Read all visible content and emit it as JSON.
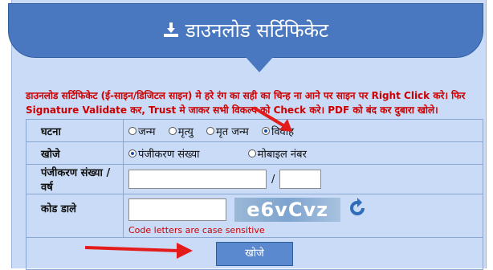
{
  "header": {
    "title": "डाउनलोड सर्टिफिकेट",
    "icon": "download-icon"
  },
  "notice": "डाउनलोड सर्टिफिकेट (ई-साइन/डिजिटल साइन) मे हरे रंग का सही का चिन्ह ना आने पर साइन पर Right Click करे। फिर Signature Validate कर, Trust मे जाकर सभी विकल्प को Check करे। PDF को बंद कर दुबारा खोले।",
  "form": {
    "event_label": "घटना",
    "event_options": [
      "जन्म",
      "मृत्यु",
      "मृत जन्म",
      "विवाह"
    ],
    "event_selected": "विवाह",
    "search_label": "खोजे",
    "search_options": [
      "पंजीकरण संख्या",
      "मोबाइल नंबर"
    ],
    "search_selected": "पंजीकरण संख्या",
    "reg_label": "पंजीकरण संख्या / वर्ष",
    "reg_separator": "/",
    "reg_value": "",
    "year_value": "",
    "code_label": "कोड डाले",
    "code_value": "",
    "captcha_text": "e6vCvz",
    "captcha_note": "Code letters are case sensitive",
    "submit_label": "खोजे"
  },
  "colors": {
    "header": "#4a78c0",
    "panel": "#c9dbf7",
    "notice": "#cc0000",
    "arrow": "#e31b1b"
  }
}
